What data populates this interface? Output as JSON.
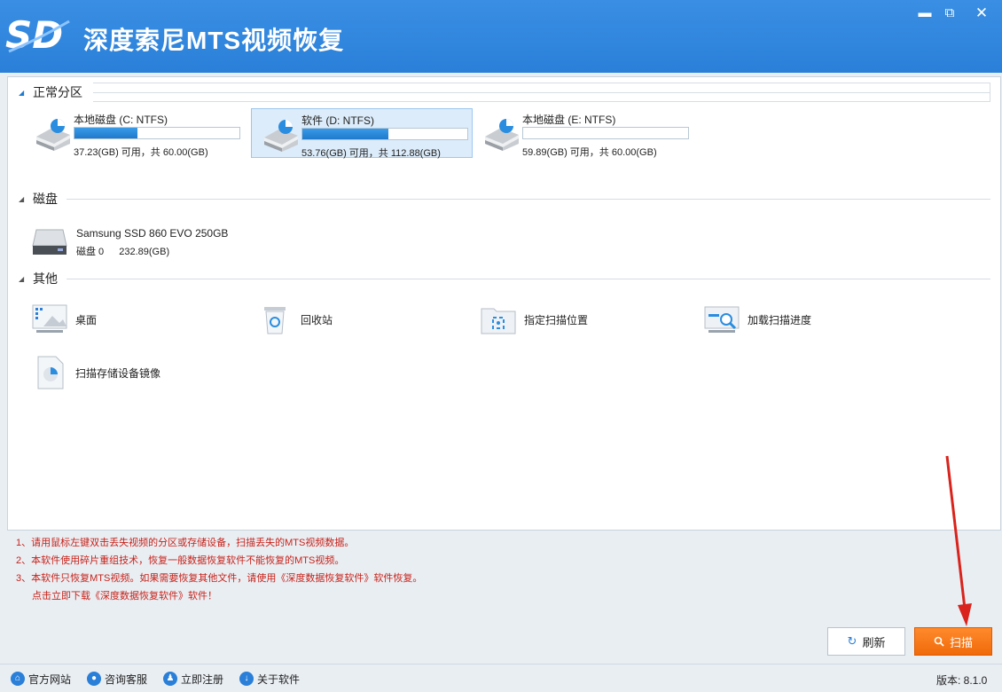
{
  "app": {
    "title": "深度索尼MTS视频恢复"
  },
  "window_controls": {
    "minimize": "▬",
    "maximize": "⧉",
    "close": "✕"
  },
  "sections": {
    "partitions": "正常分区",
    "disks": "磁盘",
    "others": "其他"
  },
  "partitions": [
    {
      "name": "本地磁盘 (C: NTFS)",
      "info": "37.23(GB) 可用，共 60.00(GB)",
      "used_fraction": 0.38,
      "selected": false
    },
    {
      "name": "软件 (D: NTFS)",
      "info": "53.76(GB) 可用，共 112.88(GB)",
      "used_fraction": 0.52,
      "selected": true
    },
    {
      "name": "本地磁盘 (E: NTFS)",
      "info": "59.89(GB) 可用，共 60.00(GB)",
      "used_fraction": 0.0,
      "selected": false
    }
  ],
  "disk": {
    "name": "Samsung SSD 860 EVO 250GB",
    "index": "磁盘 0",
    "size": "232.89(GB)"
  },
  "others": [
    {
      "label": "桌面",
      "icon": "desktop-icon"
    },
    {
      "label": "回收站",
      "icon": "recycle-bin-icon"
    },
    {
      "label": "指定扫描位置",
      "icon": "scan-location-icon"
    },
    {
      "label": "加载扫描进度",
      "icon": "load-progress-icon"
    },
    {
      "label": "扫描存储设备镜像",
      "icon": "disk-image-icon"
    }
  ],
  "tips": [
    "1、请用鼠标左键双击丢失视频的分区或存储设备，扫描丢失的MTS视频数据。",
    "2、本软件使用碎片重组技术，恢复一般数据恢复软件不能恢复的MTS视频。",
    "3、本软件只恢复MTS视频。如果需要恢复其他文件，请使用《深度数据恢复软件》软件恢复。",
    "点击立即下载《深度数据恢复软件》软件！"
  ],
  "buttons": {
    "refresh": "刷新",
    "scan": "扫描"
  },
  "footer": {
    "links": [
      "官方网站",
      "咨询客服",
      "立即注册",
      "关于软件"
    ],
    "version": "版本: 8.1.0"
  },
  "colors": {
    "accent": "#2a7fd8",
    "scan_button": "#f06a0a",
    "tip_text": "#c8231a",
    "annotation_arrow": "#d9231c"
  }
}
